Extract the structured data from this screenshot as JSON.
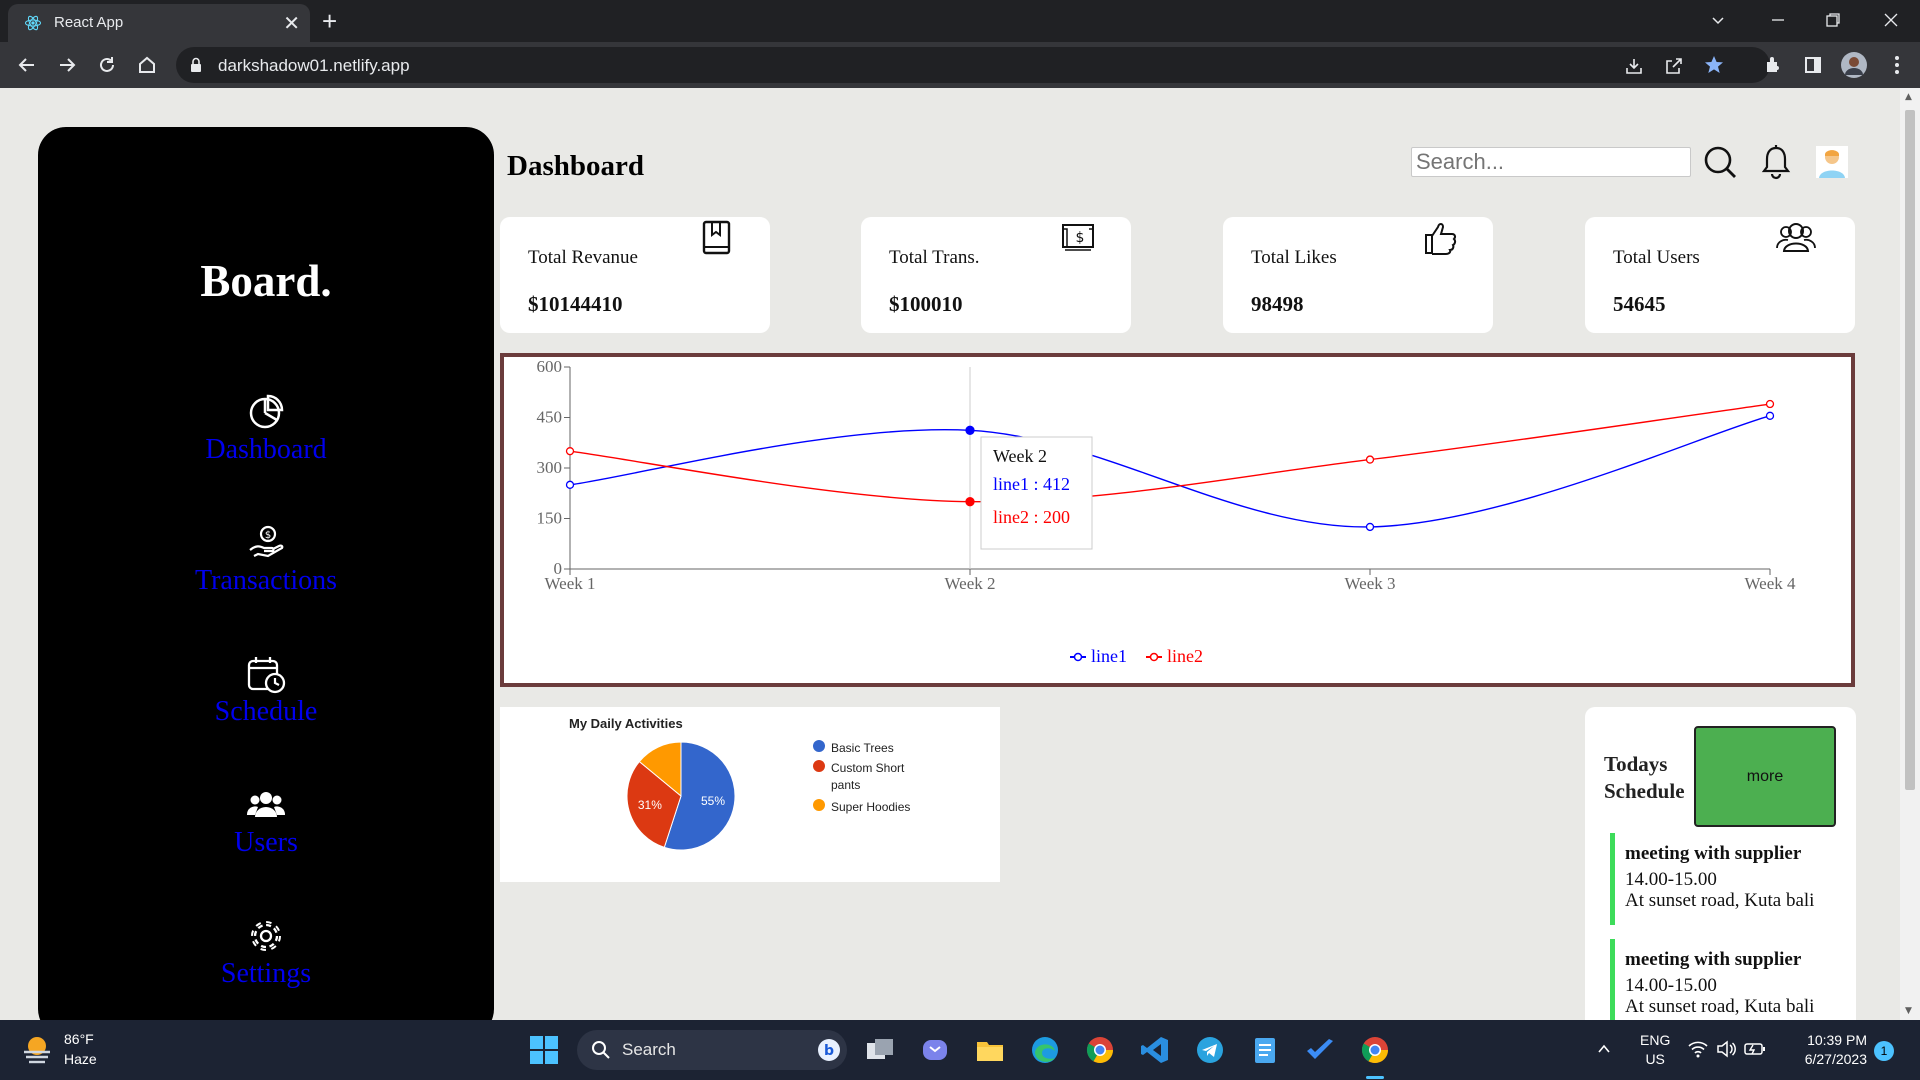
{
  "browser": {
    "tab_title": "React App",
    "tab_close": "✕",
    "new_tab": "+",
    "url": "darkshadow01.netlify.app"
  },
  "sidebar": {
    "brand": "Board.",
    "items": [
      {
        "label": "Dashboard",
        "icon": "pie-chart-icon"
      },
      {
        "label": "Transactions",
        "icon": "hand-coin-icon"
      },
      {
        "label": "Schedule",
        "icon": "calendar-clock-icon"
      },
      {
        "label": "Users",
        "icon": "users-icon"
      },
      {
        "label": "Settings",
        "icon": "gear-icon"
      }
    ]
  },
  "header": {
    "title": "Dashboard",
    "search_placeholder": "Search..."
  },
  "cards": [
    {
      "title": "Total Revanue",
      "value": "$10144410",
      "icon": "book-icon"
    },
    {
      "title": "Total Trans.",
      "value": "$100010",
      "icon": "cash-icon"
    },
    {
      "title": "Total Likes",
      "value": "98498",
      "icon": "thumbs-up-icon"
    },
    {
      "title": "Total Users",
      "value": "54645",
      "icon": "users-outline-icon"
    }
  ],
  "chart_data": [
    {
      "type": "line",
      "categories": [
        "Week 1",
        "Week 2",
        "Week 3",
        "Week 4"
      ],
      "series": [
        {
          "name": "line1",
          "color": "#0000ff",
          "values": [
            250,
            412,
            125,
            455
          ]
        },
        {
          "name": "line2",
          "color": "#ff0000",
          "values": [
            350,
            200,
            325,
            490
          ]
        }
      ],
      "y_ticks": [
        "0",
        "150",
        "300",
        "450",
        "600"
      ],
      "ylim": [
        0,
        600
      ],
      "legend_position": "bottom",
      "tooltip": {
        "title": "Week 2",
        "line1": "line1 : 412",
        "line2": "line2 : 200"
      }
    },
    {
      "type": "pie",
      "title": "My Daily Activities",
      "slices": [
        {
          "label": "Basic Trees",
          "value": 55,
          "text": "55%",
          "color": "#3366cc"
        },
        {
          "label": "Custom Short pants",
          "value": 31,
          "text": "31%",
          "color": "#dc3912"
        },
        {
          "label": "Super Hoodies",
          "value": 14,
          "text": "",
          "color": "#ff9900"
        }
      ],
      "legend_position": "right"
    }
  ],
  "schedule": {
    "title": "Todays Schedule",
    "more_label": "more",
    "events": [
      {
        "title": "meeting with supplier",
        "time": "14.00-15.00",
        "place": "At sunset road, Kuta bali"
      },
      {
        "title": "meeting with supplier",
        "time": "14.00-15.00",
        "place": "At sunset road, Kuta bali"
      }
    ]
  },
  "taskbar": {
    "temperature": "86°F",
    "condition": "Haze",
    "search": "Search",
    "lang": "ENG",
    "region": "US",
    "time": "10:39 PM",
    "date": "6/27/2023",
    "notifications": "1"
  }
}
